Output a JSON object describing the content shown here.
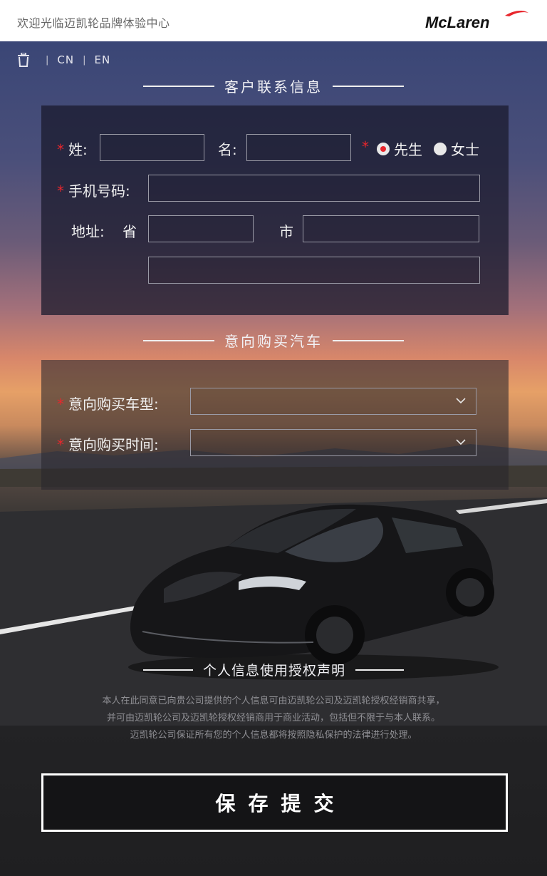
{
  "header": {
    "welcome": "欢迎光临迈凯轮品牌体验中心",
    "logo_text": "McLaren"
  },
  "toolbar": {
    "sep": "|",
    "lang_cn": "CN",
    "lang_en": "EN"
  },
  "contact_section": {
    "title": "客户联系信息",
    "surname_label": "姓:",
    "given_name_label": "名:",
    "mr_label": "先生",
    "ms_label": "女士",
    "phone_label": "手机号码:",
    "address_label": "地址:",
    "province_label": "省",
    "city_label": "市",
    "surname_value": "",
    "given_name_value": "",
    "phone_value": "",
    "province_value": "",
    "city_value": "",
    "street_value": "",
    "selected_gender": "先生"
  },
  "purchase_section": {
    "title": "意向购买汽车",
    "model_label": "意向购买车型:",
    "time_label": "意向购买时间:"
  },
  "privacy_section": {
    "title": "个人信息使用授权声明",
    "line1": "本人在此同意已向贵公司提供的个人信息可由迈凯轮公司及迈凯轮授权经销商共享，",
    "line2": "并可由迈凯轮公司及迈凯轮授权经销商用于商业活动，包括但不限于与本人联系。",
    "line3": "迈凯轮公司保证所有您的个人信息都将按照隐私保护的法律进行处理。"
  },
  "submit_label": "保存提交",
  "colors": {
    "accent_red": "#e8262c",
    "header_bg": "#ffffff",
    "button_border": "#ffffff"
  },
  "icons": [
    "trash-icon",
    "chevron-down-icon",
    "mclaren-logo"
  ]
}
